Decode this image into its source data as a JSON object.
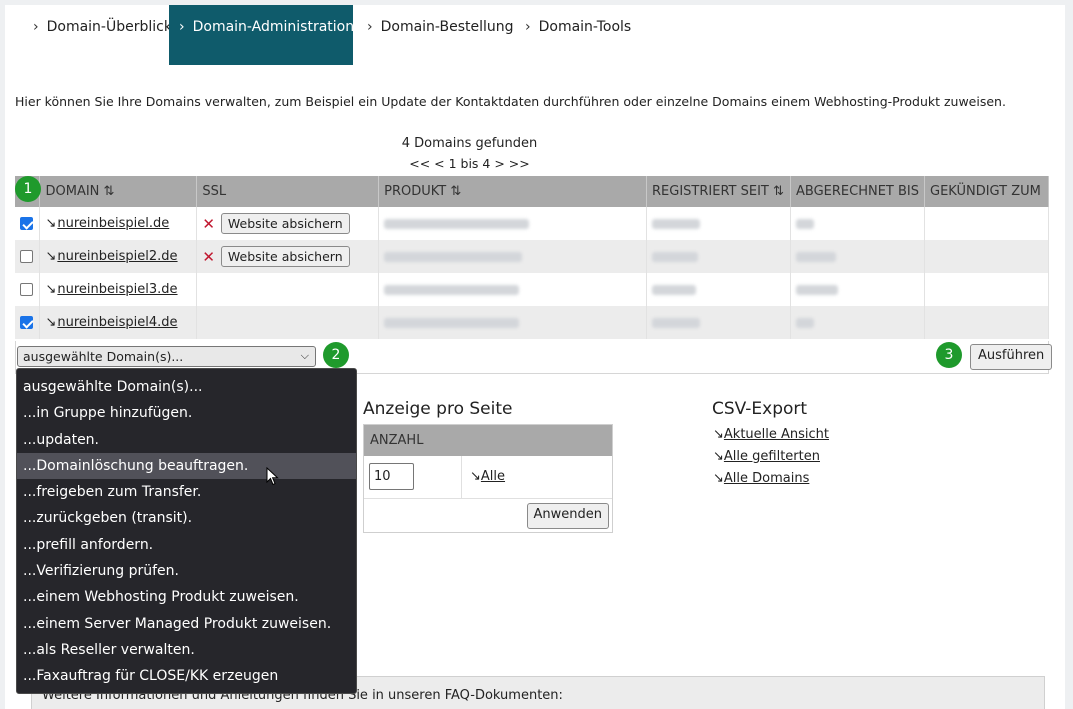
{
  "tabs": [
    {
      "label": "Domain-Überblick",
      "active": false
    },
    {
      "label": "Domain-Administration",
      "active": true
    },
    {
      "label": "Domain-Bestellung",
      "active": false
    },
    {
      "label": "Domain-Tools",
      "active": false
    }
  ],
  "intro": "Hier können Sie Ihre Domains verwalten, zum Beispiel ein Update der Kontaktdaten durchführen oder einzelne Domains einem Webhosting-Produkt zuweisen.",
  "results": {
    "found": "4 Domains gefunden",
    "pager": "<< <  1 bis 4 > >>"
  },
  "table": {
    "headers": {
      "domain": "DOMAIN",
      "ssl": "SSL",
      "product": "PRODUKT",
      "registered": "REGISTRIERT SEIT",
      "billed": "ABGERECHNET BIS",
      "cancelled": "GEKÜNDIGT ZUM"
    },
    "sort_icon": "⇅",
    "rows": [
      {
        "checked": true,
        "domain": "nureinbeispiel.de",
        "ssl_button": "Website absichern"
      },
      {
        "checked": false,
        "domain": "nureinbeispiel2.de",
        "ssl_button": "Website absichern"
      },
      {
        "checked": false,
        "domain": "nureinbeispiel3.de",
        "ssl_button": ""
      },
      {
        "checked": true,
        "domain": "nureinbeispiel4.de",
        "ssl_button": ""
      }
    ]
  },
  "badges": [
    "1",
    "2",
    "3"
  ],
  "action": {
    "select_value": "ausgewählte Domain(s)...",
    "run_label": "Ausführen",
    "options": [
      "ausgewählte Domain(s)...",
      "...in Gruppe hinzufügen.",
      "...updaten.",
      "...Domainlöschung beauftragen.",
      "...freigeben zum Transfer.",
      "...zurückgeben (transit).",
      "...prefill anfordern.",
      "...Verifizierung prüfen.",
      "...einem Webhosting Produkt zuweisen.",
      "...einem Server Managed Produkt zuweisen.",
      "...als Reseller verwalten.",
      "...Faxauftrag für CLOSE/KK erzeugen"
    ],
    "hovered_option": 3
  },
  "per_page": {
    "title": "Anzeige pro Seite",
    "header": "ANZAHL",
    "value": "10",
    "all_link": "Alle",
    "apply_label": "Anwenden"
  },
  "csv": {
    "title": "CSV-Export",
    "links": [
      "Aktuelle Ansicht",
      "Alle gefilterten",
      "Alle Domains"
    ]
  },
  "faq": "Weitere Informationen und Anleitungen finden Sie in unseren FAQ-Dokumenten:",
  "colors": {
    "active_tab": "#0f5b6b",
    "badge": "#1f9a2c",
    "table_header": "#a9a9a9",
    "dropdown_bg": "#26262b",
    "error_x": "#c0172f"
  }
}
